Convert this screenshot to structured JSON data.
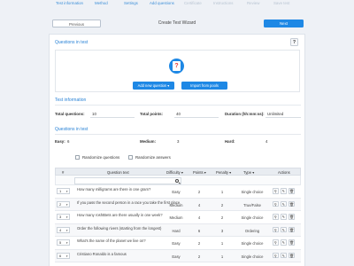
{
  "steps": [
    "Test information",
    "Method",
    "Settings",
    "Add questions",
    "Certificate",
    "Instructions",
    "Review",
    "Save test"
  ],
  "wizard": {
    "title": "Create Test Wizard",
    "previous_label": "Previous",
    "next_label": "Next"
  },
  "questions_in_test": {
    "title": "Questions in test",
    "help_label": "?",
    "add_label": "Add new question ▾",
    "import_label": "Import from pools"
  },
  "test_information": {
    "title": "Test information",
    "total_questions_label": "Total questions:",
    "total_questions_value": "10",
    "total_points_label": "Total points:",
    "total_points_value": "40",
    "duration_label": "Duration (hh:mm:ss):",
    "duration_value": "Unlimited"
  },
  "questions_in_test_stats": {
    "title": "Questions in test",
    "easy_label": "Easy:",
    "easy_value": "6",
    "medium_label": "Medium:",
    "medium_value": "3",
    "hard_label": "Hard:",
    "hard_value": "4"
  },
  "options": {
    "randomize_questions": "Randomize questions",
    "randomize_answers": "Randomize answers"
  },
  "table": {
    "headers": [
      "#",
      "Question text",
      "Difficulty ▾",
      "Points ▾",
      "Penalty ▾",
      "Type ▾",
      "Actions"
    ],
    "rows": [
      {
        "num": "1",
        "text": "How many milligrams are there in one gram?",
        "difficulty": "Easy",
        "points": "2",
        "penalty": "1",
        "type": "Single choice"
      },
      {
        "num": "2",
        "text": "If you pass the second person in a race you take the first place.",
        "difficulty": "Medium",
        "points": "4",
        "penalty": "2",
        "type": "True/False"
      },
      {
        "num": "3",
        "text": "How many roshtBets are there usually in one week?",
        "difficulty": "Medium",
        "points": "4",
        "penalty": "2",
        "type": "Single choice"
      },
      {
        "num": "4",
        "text": "Order the following rivers (starting from the longest)",
        "difficulty": "Hard",
        "points": "6",
        "penalty": "3",
        "type": "Ordering"
      },
      {
        "num": "5",
        "text": "What's the name of the planet we live on?",
        "difficulty": "Easy",
        "points": "2",
        "penalty": "1",
        "type": "Single choice"
      },
      {
        "num": "6",
        "text": "Cristiano Ronaldo is a famous",
        "difficulty": "Easy",
        "points": "2",
        "penalty": "1",
        "type": "Single choice"
      }
    ]
  },
  "icons": {
    "search": "search-icon",
    "view": "magnifier-icon",
    "edit": "pencil-icon",
    "delete": "trash-icon"
  },
  "colors": {
    "accent": "#1e88e5",
    "section_title": "#2a83d6",
    "background": "#eef1f6"
  }
}
